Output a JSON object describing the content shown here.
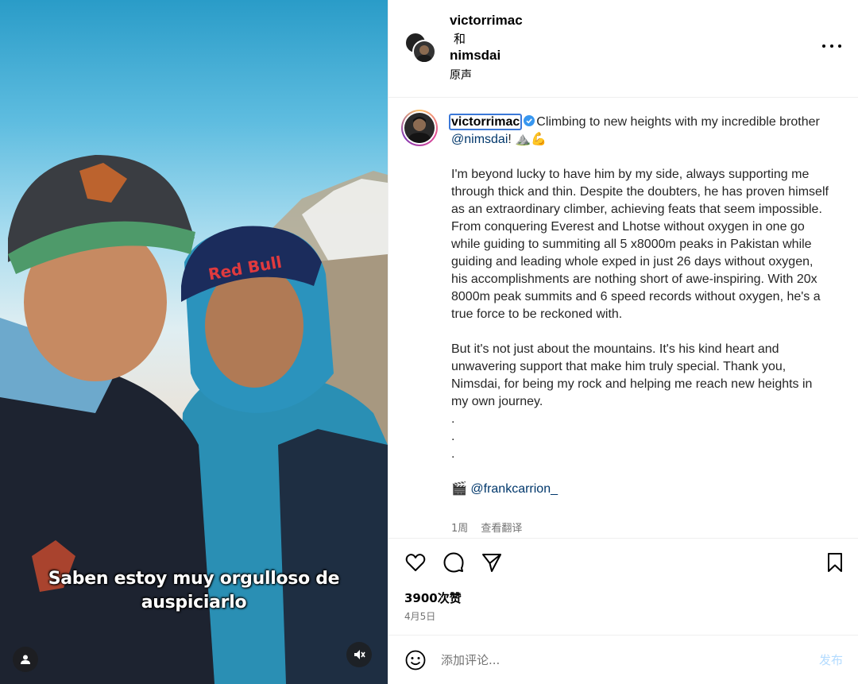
{
  "media": {
    "caption_line1": "Saben estoy muy orgulloso de",
    "caption_line2": "auspiciarlo",
    "icons": [
      "user-tag-icon",
      "mute-icon"
    ]
  },
  "header": {
    "user1": "victorrimac",
    "and": "和",
    "user2": "nimsdai",
    "audio": "原声",
    "more_icon": "more-options-icon"
  },
  "post": {
    "username": "victorrimac",
    "line1": "Climbing to new heights with my incredible brother ",
    "mention": "@nimsdai",
    "line1_end": "! ⛰️💪",
    "para2": "I'm beyond lucky to have him by my side, always supporting me through thick and thin. Despite the doubters, he has proven himself as an extraordinary climber, achieving feats that seem impossible. From conquering Everest and Lhotse without oxygen in one go while guiding to summiting all 5 x8000m peaks in Pakistan while guiding and leading whole exped in just 26 days without oxygen, his accomplishments are nothing short of awe-inspiring. With 20x 8000m peak summits and 6 speed records without oxygen, he's a true force to be reckoned with.",
    "para3": "But it's not just about the mountains. It's his kind heart and unwavering support that make him truly special. Thank you, Nimsdai, for being my rock and helping me reach new heights in my own journey.",
    "dots": [
      ".",
      ".",
      "."
    ],
    "credit_emoji": "🎬",
    "credit_mention": "@frankcarrion_",
    "time_ago": "1周",
    "translate": "查看翻译"
  },
  "actions": {
    "likes": "3900次赞",
    "date": "4月5日"
  },
  "comment": {
    "placeholder": "添加评论...",
    "post_label": "发布"
  },
  "colors": {
    "link": "#00376b",
    "post_button_disabled": "#b3dbff",
    "secondary_text": "#737373",
    "verified": "#3897f0"
  }
}
